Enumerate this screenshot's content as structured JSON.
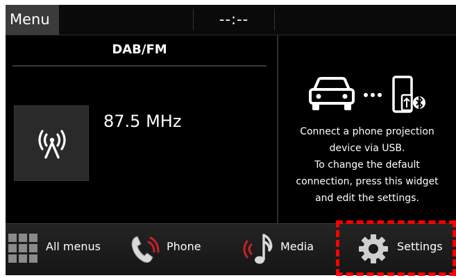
{
  "status_bar": {
    "menu_label": "Menu",
    "clock": "--:--"
  },
  "radio_widget": {
    "title": "DAB/FM",
    "frequency": "87.5 MHz",
    "icon": "antenna-broadcast-icon"
  },
  "projection_widget": {
    "icons": [
      "car-icon",
      "ellipsis-icon",
      "phone-usb-bluetooth-icon"
    ],
    "lines": [
      "Connect a phone projection",
      "device via USB.",
      "To change the default",
      "connection, press this widget",
      "and edit the settings."
    ]
  },
  "bottom_bar": {
    "items": [
      {
        "label": "All menus",
        "icon": "grid-icon"
      },
      {
        "label": "Phone",
        "icon": "phone-handset-icon"
      },
      {
        "label": "Media",
        "icon": "music-note-icon"
      },
      {
        "label": "Settings",
        "icon": "gear-icon"
      }
    ]
  },
  "colors": {
    "background": "#000000",
    "highlight": "#ff0000",
    "accent_red": "#c8202a",
    "text": "#ffffff"
  }
}
